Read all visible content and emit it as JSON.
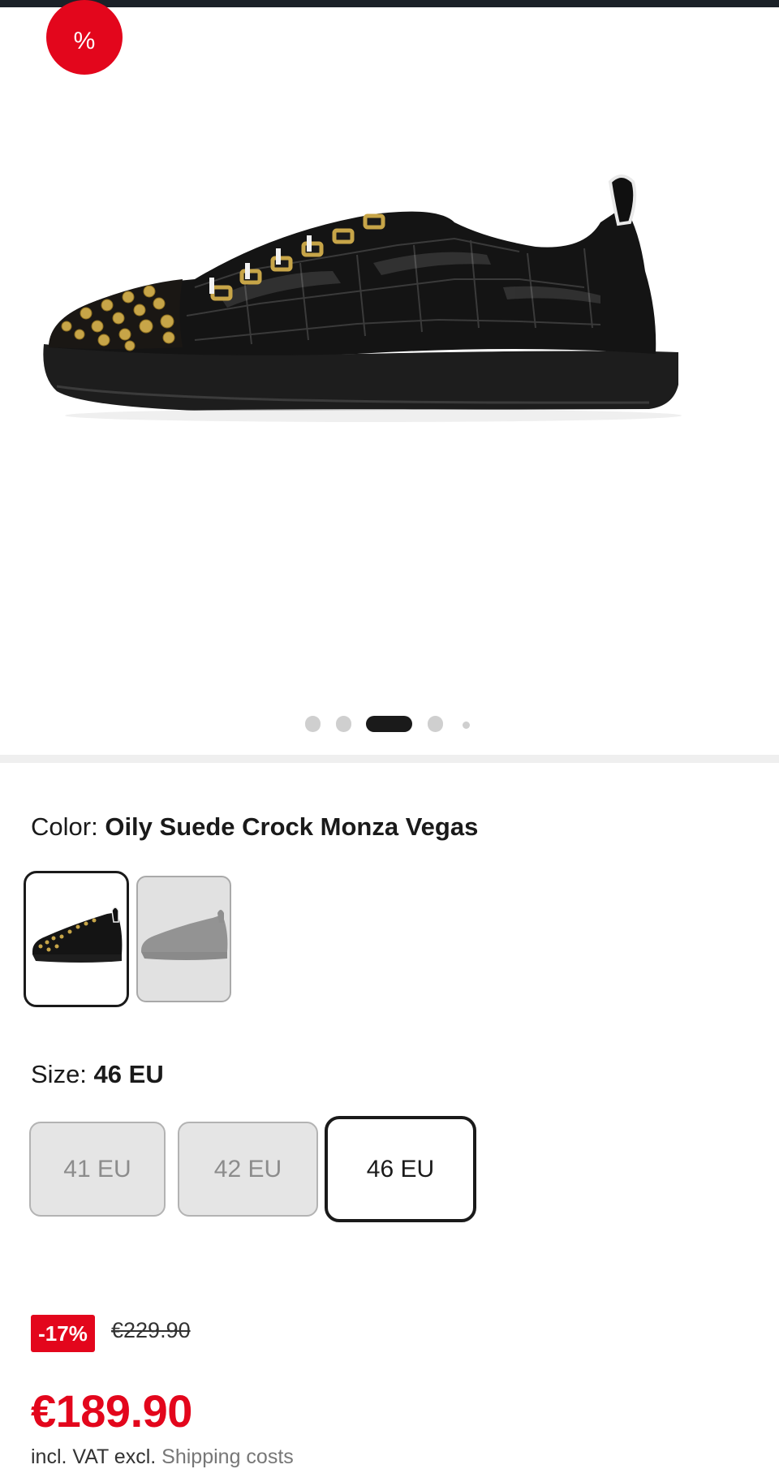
{
  "gallery": {
    "discount_symbol": "%",
    "product_image_alt": "Black glossy croc-embossed sneaker with gold spikes",
    "slides": 5,
    "active_slide": 3
  },
  "color": {
    "label": "Color:",
    "value": "Oily Suede Crock Monza Vegas",
    "swatches": [
      {
        "name": "black-studded",
        "selected": true
      },
      {
        "name": "grey",
        "selected": false
      }
    ]
  },
  "size": {
    "label": "Size:",
    "value": "46 EU",
    "options": [
      {
        "label": "41 EU",
        "available": false
      },
      {
        "label": "42 EU",
        "available": false
      },
      {
        "label": "46 EU",
        "available": true,
        "selected": true
      }
    ]
  },
  "pricing": {
    "discount_badge": "-17%",
    "old_price": "€229.90",
    "price": "€189.90",
    "vat_prefix": "incl. VAT excl.",
    "shipping_link": "Shipping costs"
  },
  "colors": {
    "accent_red": "#e3061c",
    "text_dark": "#1a1a1a"
  }
}
